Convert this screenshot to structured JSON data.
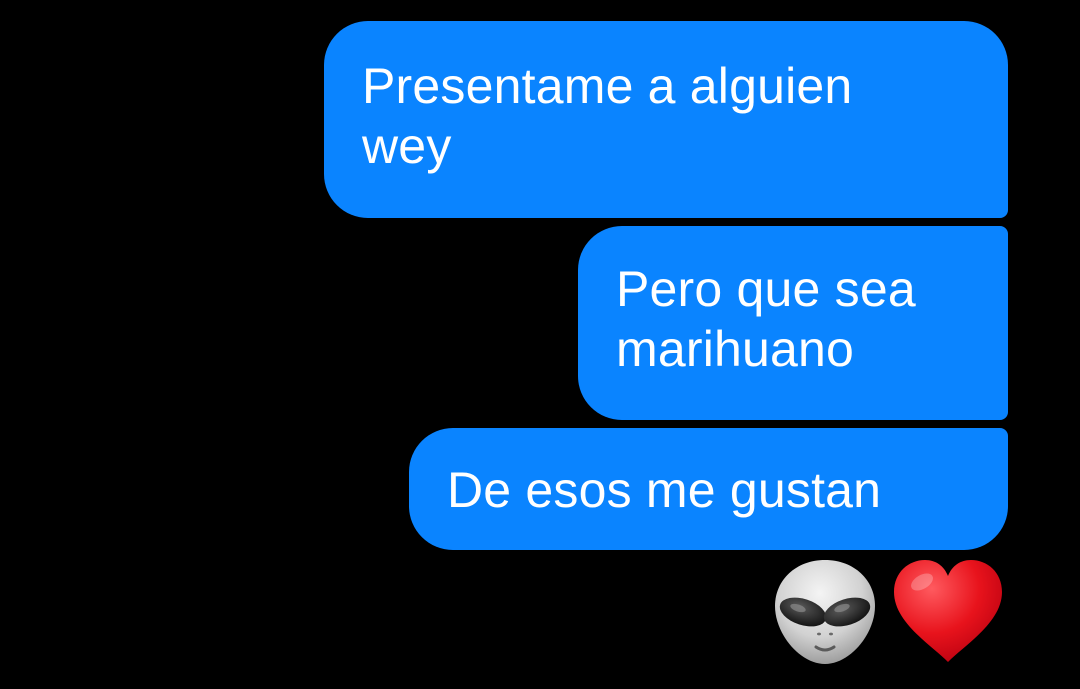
{
  "messages": [
    {
      "lines": [
        "Presentame a alguien",
        "wey"
      ]
    },
    {
      "lines": [
        "Pero que sea",
        "marihuano"
      ]
    },
    {
      "lines": [
        "De esos me gustan"
      ]
    }
  ],
  "reaction": {
    "icons": [
      "alien-icon",
      "red-heart-icon"
    ]
  },
  "colors": {
    "background": "#000000",
    "bubble": "#0a84ff",
    "bubble_text": "#ffffff",
    "heart": "#e8131c"
  }
}
